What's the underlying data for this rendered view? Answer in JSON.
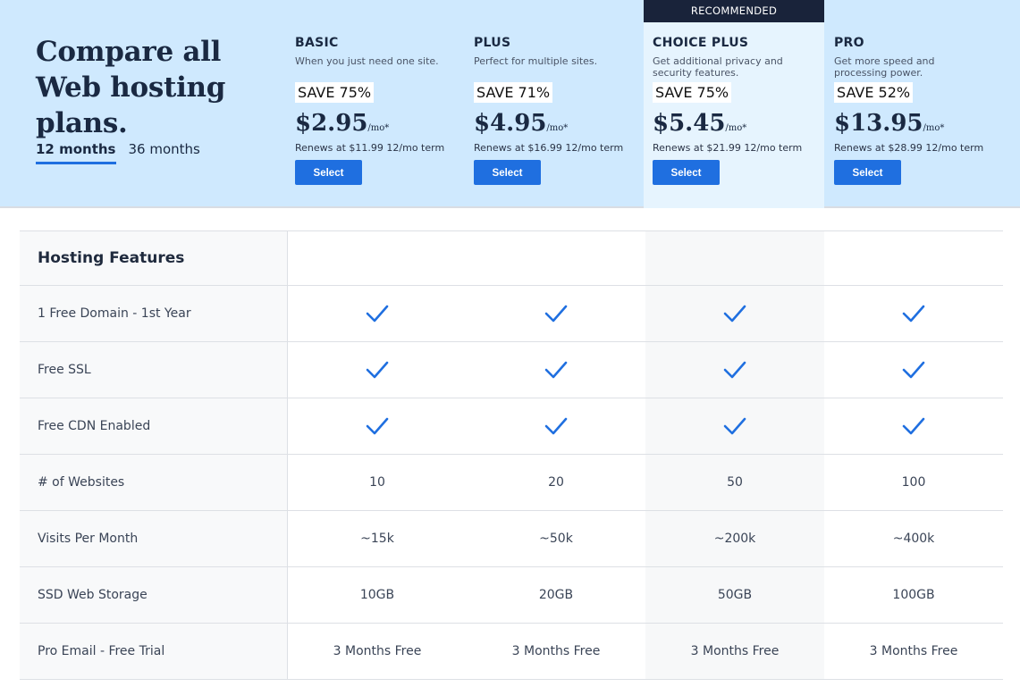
{
  "headline": "Compare all Web hosting plans.",
  "terms": [
    "12 months",
    "36 months"
  ],
  "active_term": "12 months",
  "recommended_label": "RECOMMENDED",
  "plans": [
    {
      "name": "BASIC",
      "desc": "When you just need one site.",
      "save": "SAVE 75%",
      "price": "$2.95",
      "per": "/mo*",
      "renews": "Renews at $11.99 12/mo term",
      "button": "Select"
    },
    {
      "name": "PLUS",
      "desc": "Perfect for multiple sites.",
      "save": "SAVE 71%",
      "price": "$4.95",
      "per": "/mo*",
      "renews": "Renews at $16.99 12/mo term",
      "button": "Select"
    },
    {
      "name": "CHOICE PLUS",
      "desc": "Get additional privacy and security features.",
      "save": "SAVE 75%",
      "price": "$5.45",
      "per": "/mo*",
      "renews": "Renews at $21.99 12/mo term",
      "button": "Select"
    },
    {
      "name": "PRO",
      "desc": "Get more speed and processing power.",
      "save": "SAVE 52%",
      "price": "$13.95",
      "per": "/mo*",
      "renews": "Renews at $28.99 12/mo term",
      "button": "Select"
    }
  ],
  "table": {
    "section_title": "Hosting Features",
    "check_icon": "checkmark-icon",
    "accent_color": "#1f6fe0",
    "rows": [
      {
        "label": "1 Free Domain - 1st Year",
        "values": [
          "check",
          "check",
          "check",
          "check"
        ]
      },
      {
        "label": "Free SSL",
        "values": [
          "check",
          "check",
          "check",
          "check"
        ]
      },
      {
        "label": "Free CDN Enabled",
        "values": [
          "check",
          "check",
          "check",
          "check"
        ]
      },
      {
        "label": "# of Websites",
        "values": [
          "10",
          "20",
          "50",
          "100"
        ]
      },
      {
        "label": "Visits Per Month",
        "values": [
          "~15k",
          "~50k",
          "~200k",
          "~400k"
        ]
      },
      {
        "label": "SSD Web Storage",
        "values": [
          "10GB",
          "20GB",
          "50GB",
          "100GB"
        ]
      },
      {
        "label": "Pro Email - Free Trial",
        "values": [
          "3 Months Free",
          "3 Months Free",
          "3 Months Free",
          "3 Months Free"
        ]
      }
    ]
  }
}
